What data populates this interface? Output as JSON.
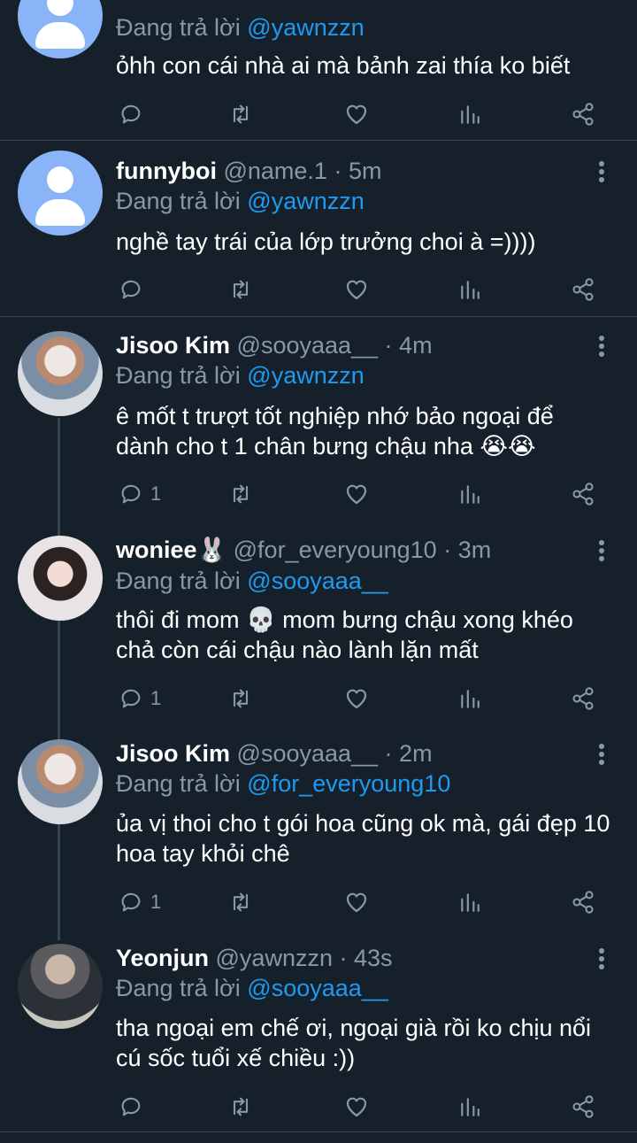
{
  "reply_prefix": "Đang trả lời",
  "tweets": [
    {
      "name": "",
      "meta": "",
      "reply_to": "@yawnzzn",
      "text": "ỏhh con cái nhà ai mà bảnh zai thía ko biết",
      "reply_count": ""
    },
    {
      "name": "funnyboi",
      "meta": " @name.1 · 5m",
      "reply_to": "@yawnzzn",
      "text": "nghề tay trái của lớp trưởng choi à =))))",
      "reply_count": ""
    },
    {
      "name": "Jisoo Kim",
      "meta": " @sooyaaa__ · 4m",
      "reply_to": "@yawnzzn",
      "text": "ê mốt t trượt tốt nghiệp nhớ bảo ngoại để dành cho t 1 chân bưng chậu nha 😭😭",
      "reply_count": "1"
    },
    {
      "name": "woniee🐰",
      "meta": " @for_everyoung10 · 3m",
      "reply_to": "@sooyaaa__",
      "text": "thôi đi mom 💀 mom bưng chậu xong khéo chả còn cái chậu nào lành lặn mất",
      "reply_count": "1"
    },
    {
      "name": "Jisoo Kim",
      "meta": " @sooyaaa__ · 2m",
      "reply_to": "@for_everyoung10",
      "text": "ủa vị thoi cho t gói hoa cũng ok mà, gái đẹp 10 hoa tay khỏi chê",
      "reply_count": "1"
    },
    {
      "name": "Yeonjun",
      "meta": " @yawnzzn · 43s",
      "reply_to": "@sooyaaa__",
      "text": "tha ngoại em chế ơi, ngoại già rồi ko chịu nổi cú sốc tuổi xế chiều :))",
      "reply_count": ""
    }
  ],
  "colors": {
    "background": "#15202b",
    "secondary_text": "#8899a6",
    "mention": "#1d9bf0",
    "divider": "#38444d"
  }
}
